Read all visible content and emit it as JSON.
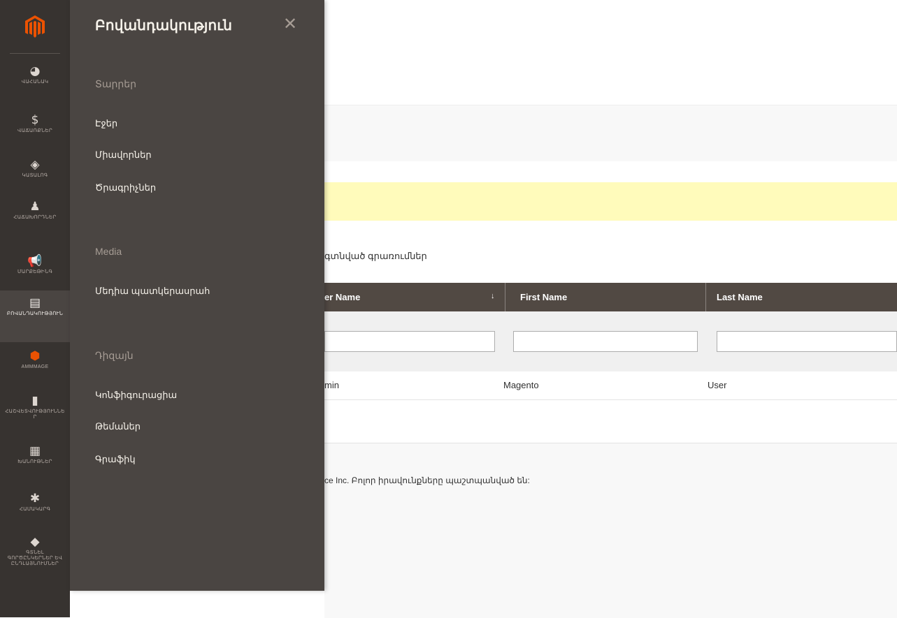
{
  "rail": {
    "brand_color": "#eb5202",
    "items": [
      {
        "icon": "dashboard-icon",
        "glyph": "◕",
        "label": "ՎԱՀԱՆԱԿ"
      },
      {
        "icon": "dollar-icon",
        "glyph": "$",
        "label": "ՎԱՃԱՌՔՆԵՐ"
      },
      {
        "icon": "box-icon",
        "glyph": "◈",
        "label": "ԿԱՏԱԼՈԳ"
      },
      {
        "icon": "person-icon",
        "glyph": "♟",
        "label": "ՀԱՃԱԽՈՐԴՆԵՐ"
      },
      {
        "icon": "megaphone-icon",
        "glyph": "📢",
        "label": "ՄԱՐՔԵԹԻՆԳ"
      },
      {
        "icon": "content-icon",
        "glyph": "▤",
        "label": "ԲՈՎԱՆԴԱԿՈՒԹՅՈՒՆ"
      },
      {
        "icon": "magento-icon",
        "glyph": "⬢",
        "label": "AMMMAGE"
      },
      {
        "icon": "bar-chart-icon",
        "glyph": "▮",
        "label": "ՀԱՇՎԵՏՎՈՒԹՅՈՒՆՆԵՐ"
      },
      {
        "icon": "store-icon",
        "glyph": "▦",
        "label": "ԽԱՆՈՒԹՆԵՐ"
      },
      {
        "icon": "gear-icon",
        "glyph": "✱",
        "label": "ՀԱՄԱԿԱՐԳ"
      },
      {
        "icon": "extensions-icon",
        "glyph": "◆",
        "label": "ԳՏՆԵԼ ԳՈՐԾԸՆԿԵՐՆԵՐ ԵՎ ԸՆԴԼԱՅՆՈՒՄՆԵՐ"
      }
    ]
  },
  "flyout": {
    "title": "Բովանդակություն",
    "close_glyph": "✕",
    "sections": [
      {
        "heading": "Տարրեր",
        "links": [
          "Էջեր",
          "Միավորներ",
          "Ծրագրիչներ"
        ]
      },
      {
        "heading": "Media",
        "links": [
          "Մեդիա պատկերասրահ"
        ]
      },
      {
        "heading": "Դիզայն",
        "links": [
          "Կոնֆիգուրացիա",
          "Թեմաներ",
          "Գրաֆիկ"
        ]
      }
    ]
  },
  "grid": {
    "records_text": "գտնված գրառումներ",
    "sort_glyph": "↓",
    "columns": [
      "er Name",
      "First Name",
      "Last Name"
    ],
    "rows": [
      [
        "min",
        "Magento",
        "User"
      ]
    ]
  },
  "footer": {
    "text": "ce Inc. Բոլոր իրավունքները պաշտպանված են:"
  }
}
